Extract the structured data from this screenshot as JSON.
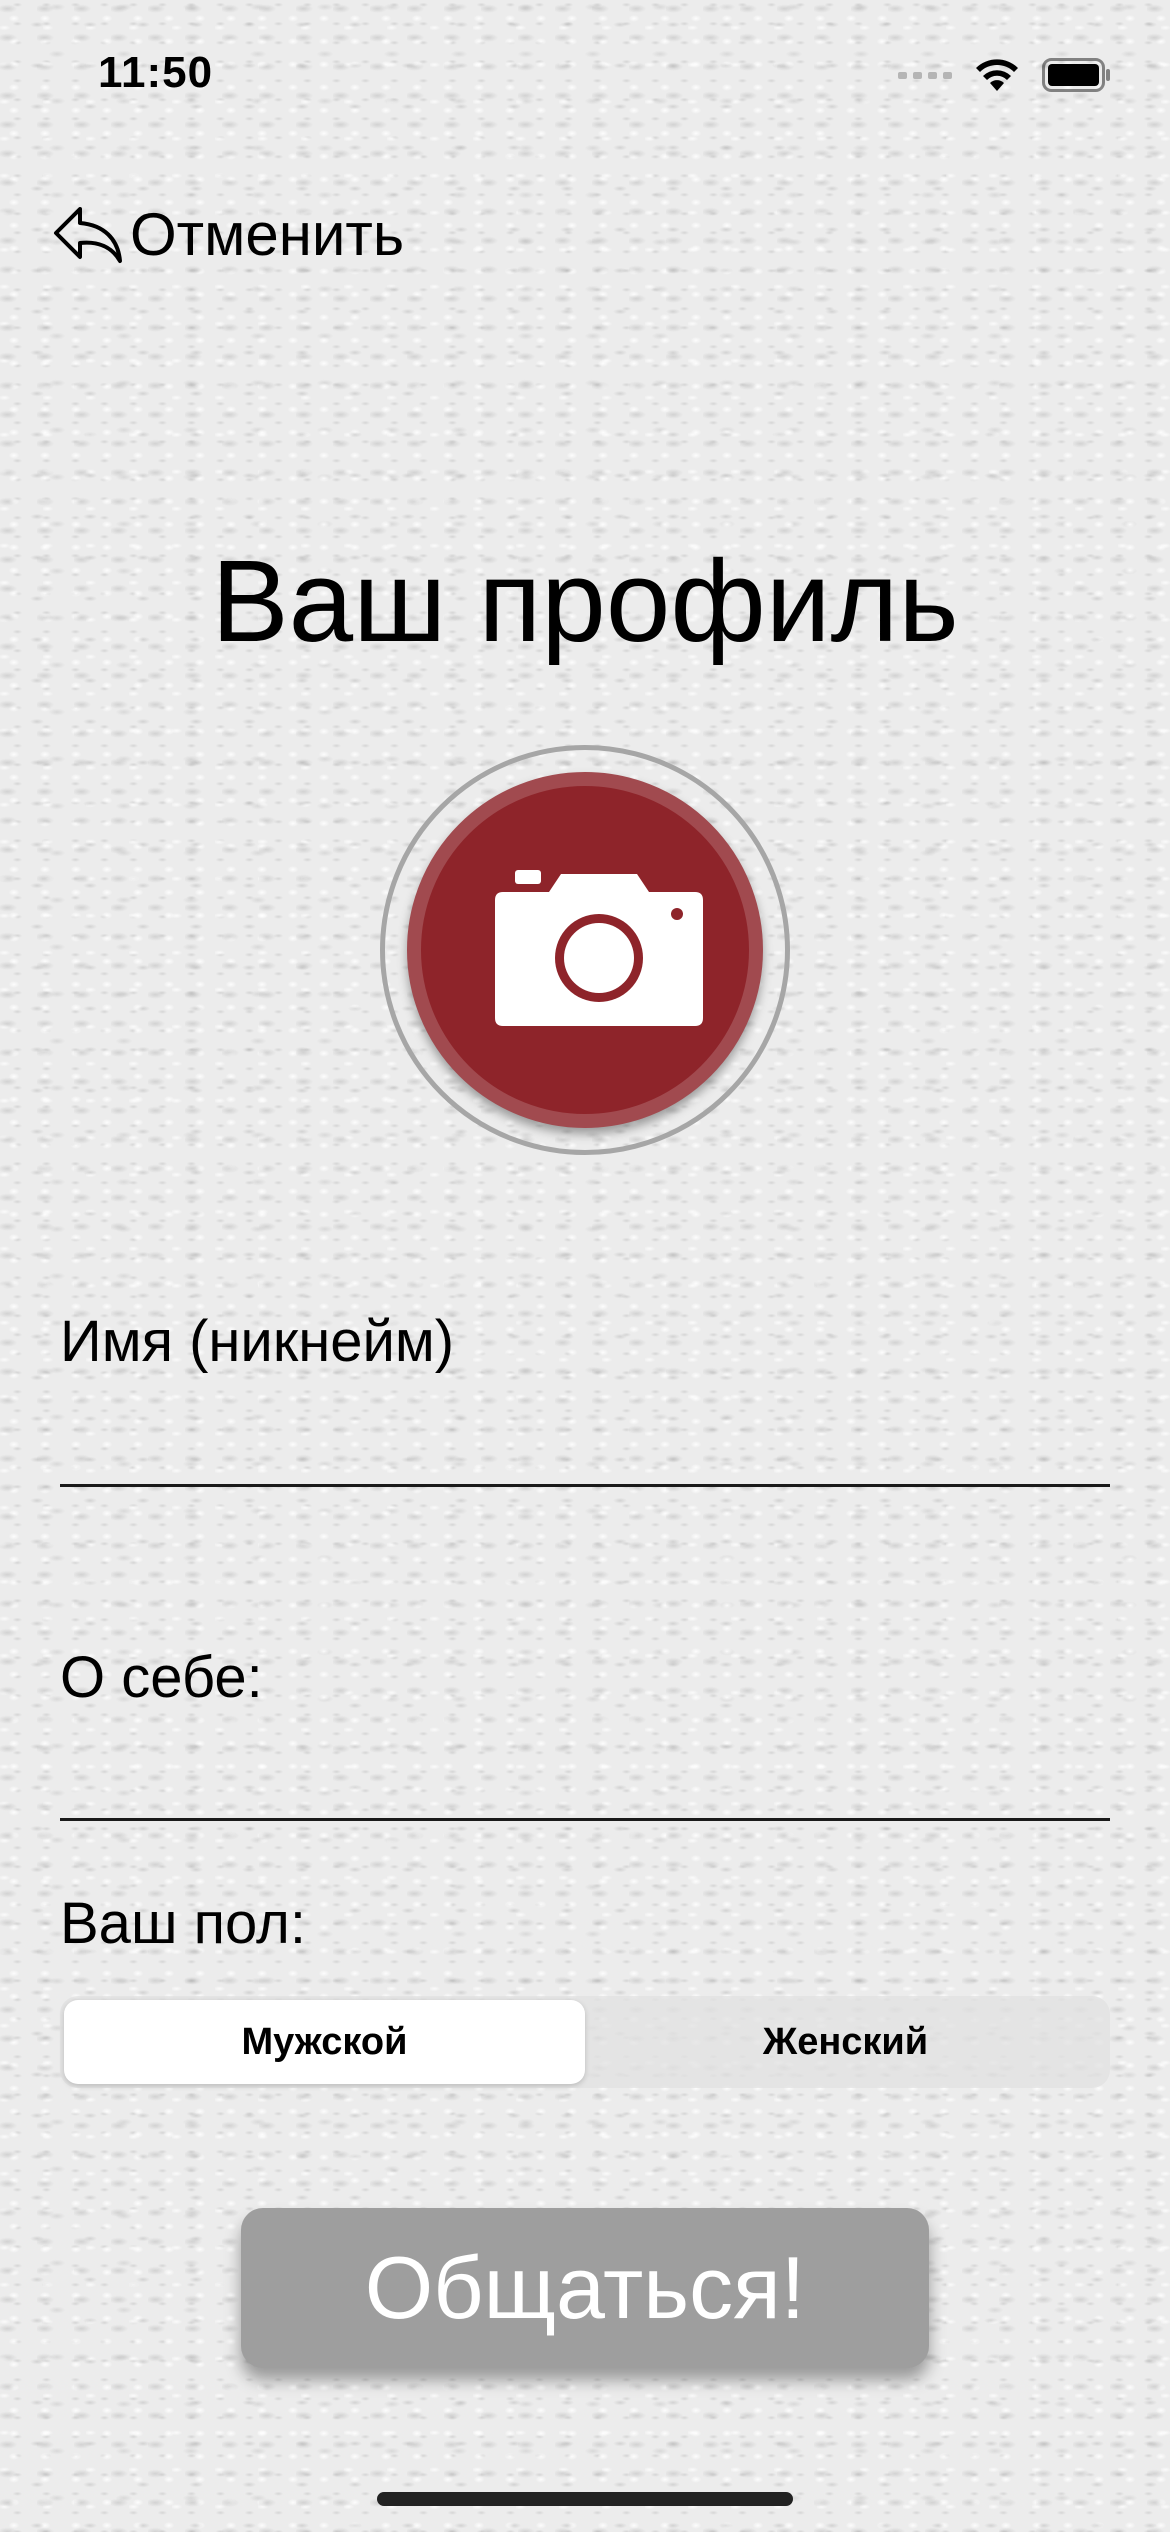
{
  "status_bar": {
    "time": "11:50",
    "signal_icon": "cellular-signal-icon",
    "wifi_icon": "wifi-icon",
    "battery_icon": "battery-icon"
  },
  "nav": {
    "cancel_label": "Отменить",
    "cancel_icon": "back-arrow-icon"
  },
  "title": "Ваш профиль",
  "avatar": {
    "icon": "camera-icon",
    "color": "#8e242a"
  },
  "form": {
    "name_label": "Имя (никнейм)",
    "name_value": "",
    "about_label": "О себе:",
    "about_value": "",
    "gender_label": "Ваш пол:",
    "gender_options": [
      "Мужской",
      "Женский"
    ],
    "gender_selected": "Мужской"
  },
  "actions": {
    "chat_label": "Общаться!"
  }
}
